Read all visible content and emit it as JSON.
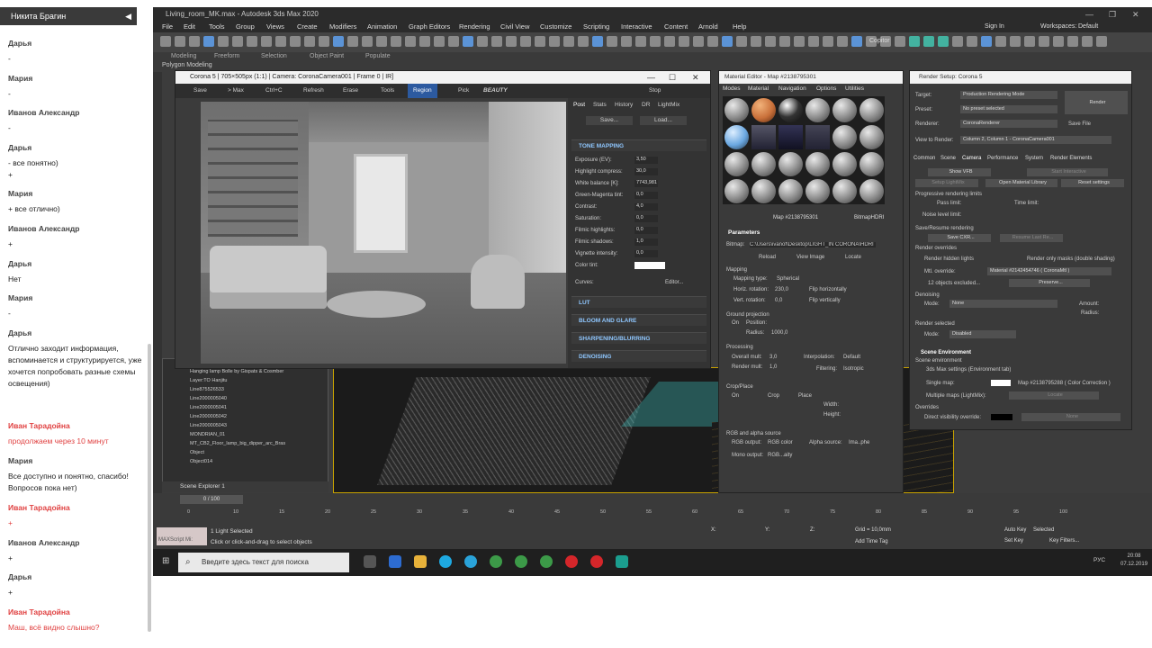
{
  "chat": {
    "header": "Никита Брагин",
    "collapse_icon": "◀",
    "messages": [
      {
        "name": "Дарья",
        "text": "-",
        "red": false
      },
      {
        "name": "Мария",
        "text": "-",
        "red": false
      },
      {
        "name": "Иванов Александр",
        "text": "-",
        "red": false
      },
      {
        "name": "Дарья",
        "text": "- все понятно)\n+",
        "red": false
      },
      {
        "name": "Мария",
        "text": "+ все отлично)",
        "red": false
      },
      {
        "name": "Иванов Александр",
        "text": "+",
        "red": false
      },
      {
        "name": "Дарья",
        "text": "Нет",
        "red": false
      },
      {
        "name": "Мария",
        "text": "-",
        "red": false
      },
      {
        "name": "Дарья",
        "text": "Отлично заходит информация, вспоминается и структурируется, уже хочется попробовать разные схемы освещения)",
        "red": false
      },
      {
        "name": "Иван Тарадойна",
        "text": "продолжаем через 10 минут",
        "red": true
      },
      {
        "name": "Мария",
        "text": "Все доступно и понятно, спасибо! Вопросов пока нет)",
        "red": false
      },
      {
        "name": "Иван Тарадойна",
        "text": "+",
        "red": true
      },
      {
        "name": "Иванов Александр",
        "text": "+",
        "red": false
      },
      {
        "name": "Дарья",
        "text": "+",
        "red": false
      },
      {
        "name": "Иван Тарадойна",
        "text": "Маш, всё видно слышно?",
        "red": true
      }
    ]
  },
  "app": {
    "title": "Living_room_MK.max - Autodesk 3ds Max 2020",
    "menu": [
      "File",
      "Edit",
      "Tools",
      "Group",
      "Views",
      "Create",
      "Modifiers",
      "Animation",
      "Graph Editors",
      "Rendering",
      "Civil View",
      "Customize",
      "Scripting",
      "Interactive",
      "Content",
      "Arnold",
      "Help"
    ],
    "sign_in": "Sign In",
    "workspaces_label": "Workspaces:",
    "workspaces_value": "Default",
    "ribbon": [
      "Modeling",
      "Freeform",
      "Selection",
      "Object Paint",
      "Populate"
    ],
    "ribbon_sub": "Polygon Modeling",
    "copitor": "Copitor"
  },
  "vfb": {
    "title": "Corona 5 | 705×505px (1:1) | Camera: CoronaCamera001 | Frame 0 | IR]",
    "tools": [
      "Save",
      "> Max",
      "Ctrl+C",
      "Refresh",
      "Erase",
      "Tools",
      "Region",
      "Pick",
      "BEAUTY",
      "Stop"
    ],
    "panel_tabs": [
      "Post",
      "Stats",
      "History",
      "DR",
      "LightMix"
    ],
    "save_btn": "Save...",
    "load_btn": "Load...",
    "sections": {
      "tone": "TONE MAPPING",
      "lut": "LUT",
      "bloom": "BLOOM AND GLARE",
      "sharp": "SHARPENING/BLURRING",
      "denoise": "DENOISING"
    },
    "params": [
      {
        "label": "Exposure (EV):",
        "value": "3,50"
      },
      {
        "label": "Highlight compress:",
        "value": "30,0"
      },
      {
        "label": "White balance [K]:",
        "value": "7743,981"
      },
      {
        "label": "Green-Magenta tint:",
        "value": "0,0"
      },
      {
        "label": "Contrast:",
        "value": "4,0"
      },
      {
        "label": "Saturation:",
        "value": "0,0"
      },
      {
        "label": "Filmic highlights:",
        "value": "0,0"
      },
      {
        "label": "Filmic shadows:",
        "value": "1,0"
      },
      {
        "label": "Vignette intensity:",
        "value": "0,0"
      },
      {
        "label": "Color tint:",
        "value": ""
      }
    ],
    "curves": "Curves:",
    "editor": "Editor..."
  },
  "mated": {
    "title": "Material Editor - Map #2138795301",
    "menu": [
      "Modes",
      "Material",
      "Navigation",
      "Options",
      "Utilities"
    ],
    "map_name": "Map #2138795301",
    "map_type": "BitmapHDRI",
    "parameters": "Parameters",
    "bitmap_label": "Bitmap:",
    "bitmap_path": "C:\\Users\\ivanof\\Desktop\\LIGHT_IN CORONA\\HDRI",
    "reload": "Reload",
    "view_image": "View Image",
    "locate": "Locate",
    "mapping": "Mapping",
    "mapping_type_label": "Mapping type:",
    "mapping_type": "Spherical",
    "horiz_rotation_label": "Horiz. rotation:",
    "horiz_rotation": "230,0",
    "flip_h": "Flip horizontally",
    "vert_rotation_label": "Vert. rotation:",
    "vert_rotation": "0,0",
    "flip_v": "Flip vertically",
    "ground_projection": "Ground projection",
    "on": "On",
    "position_label": "Position:",
    "radius_label": "Radius:",
    "radius": "1000,0",
    "processing": "Processing",
    "overall_mult_label": "Overall mult:",
    "overall_mult": "3,0",
    "interpolation_label": "Interpolation:",
    "interpolation": "Default",
    "render_mult_label": "Render mult:",
    "render_mult": "1,0",
    "filtering_label": "Filtering:",
    "filtering": "Isotropic",
    "crop_place": "Crop/Place",
    "crop": "Crop",
    "place": "Place",
    "width_label": "Width:",
    "height_label": "Height:",
    "rgb_alpha": "RGB and alpha source",
    "rgb_output_label": "RGB output:",
    "rgb_output": "RGB color",
    "alpha_source_label": "Alpha source:",
    "alpha_source": "Ima..phe",
    "mono_output_label": "Mono output:",
    "mono_output": "RGB...aity"
  },
  "rsetup": {
    "title": "Render Setup: Corona 5",
    "target_label": "Target:",
    "target": "Production Rendering Mode",
    "preset_label": "Preset:",
    "preset": "No preset selected",
    "renderer_label": "Renderer:",
    "renderer": "CoronaRenderer",
    "save_file": "Save File",
    "view_label": "View to Render:",
    "view": "Column 2, Column 1 - CoronaCamera001",
    "render_btn": "Render",
    "tabs": [
      "Common",
      "Scene",
      "Camera",
      "Performance",
      "System",
      "Render Elements"
    ],
    "show_vfb": "Show VFB",
    "start_interactive": "Start Interactive",
    "setup_lightmix": "Setup LightMix",
    "open_material_library": "Open Material Library",
    "reset_settings": "Reset settings",
    "progressive": "Progressive rendering limits",
    "pass_limit": "Pass limit:",
    "time_limit": "Time limit:",
    "noise_limit": "Noise level limit:",
    "save_resume": "Save/Resume rendering",
    "save_cxr": "Save CXR...",
    "resume": "Resume Last Re...",
    "overrides": "Render overrides",
    "render_hidden": "Render hidden lights",
    "render_masks": "Render only masks (double shading)",
    "mtl_override": "Mtl. override:",
    "mtl_override_val": "Material #2142454746  ( CoronaMtl )",
    "excluded": "12 objects excluded...",
    "preserve": "Preserve...",
    "denoising": "Denoising",
    "mode_label": "Mode:",
    "denoise_mode": "None",
    "amount": "Amount:",
    "radius": "Radius:",
    "render_selected": "Render selected",
    "render_sel_mode": "Disabled",
    "scene_env": "Scene Environment",
    "scene_env_sub": "Scene environment",
    "use_3dsmax": "3ds Max settings (Environment tab)",
    "single_map": "Single map:",
    "single_map_val": "Map #2138795288  ( Color Correction )",
    "multiple_maps": "Multiple maps (LightMix):",
    "locate": "Locate",
    "overrides2": "Overrides",
    "direct_vis": "Direct visibility override:",
    "none": "None"
  },
  "scene": {
    "rows": [
      "Hanging lamp Bolle by Gispats & Cosmber",
      "Layer:TO Hanjitu",
      "Line875526533",
      "Line2000005040",
      "Line2000005041",
      "Line2000005042",
      "Line2000005043",
      "MONDRIAN_01",
      "MT_CB2_Floor_lamp_big_dipper_arc_Bras",
      "Object",
      "Object014"
    ],
    "footer": "Scene Explorer 1"
  },
  "timeline": {
    "frame": "0 / 100",
    "ticks": [
      "0",
      "10",
      "15",
      "20",
      "25",
      "30",
      "35",
      "40",
      "45",
      "50",
      "55",
      "60",
      "65",
      "70",
      "75",
      "80",
      "85",
      "90",
      "95",
      "100"
    ]
  },
  "status": {
    "maxscript": "MAXScript Mi:",
    "selected": "1 Light Selected",
    "hint": "Click or click-and-drag to select objects",
    "x_label": "X:",
    "y_label": "Y:",
    "z_label": "Z:",
    "grid": "Grid = 10,0mm",
    "add_time_tag": "Add Time Tag",
    "auto_key": "Auto Key",
    "set_key": "Set Key",
    "selected_dd": "Selected",
    "key_filters": "Key Filters..."
  },
  "taskbar": {
    "search_placeholder": "Введите здесь текст для поиска",
    "lang": "РУС",
    "time": "20:08",
    "date": "07.12.2019"
  }
}
